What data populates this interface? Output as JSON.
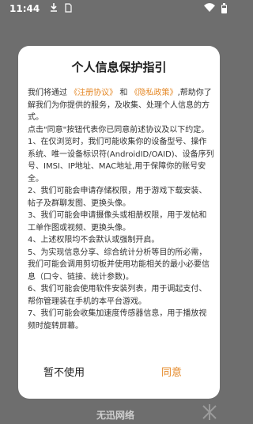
{
  "status_bar": {
    "time": "11:44",
    "icons": [
      "download-icon",
      "sim-card-icon",
      "wifi-icon",
      "battery-icon"
    ]
  },
  "dialog": {
    "title": "个人信息保护指引",
    "intro_prefix": "我们将通过",
    "link_terms": "《注册协议》",
    "intro_and": "和",
    "link_privacy": "《隐私政策》",
    "intro_suffix": ",帮助你了解我们为你提供的服务，及收集、处理个人信息的方式。",
    "consent_note": "点击\"同意\"按钮代表你已同意前述协议及以下约定。",
    "items": [
      "1、在仅浏览时，我们可能收集你的设备型号、操作系统、唯一设备标识符(AndroidID/OAID)、设备序列号、IMSI、IP地址、MAC地址,用于保障你的账号安全。",
      "2、我们可能会申请存储权限，用于游戏下载安装、帖子及群聊发图、更换头像。",
      "3、我们可能会申请摄像头或相册权限，用于发帖和工单作图或视频、更换头像。",
      "4、上述权限均不会默认或强制开启。",
      "5、为实现信息分享、综合统计分析等目的所必需，我们可能会调用剪切板并使用功能相关的最小必要信息（口令、链接、统计参数)。",
      "6、我们可能会使用软件安装列表，用于调起支付、帮你管理装在手机的本平台游戏。",
      "7、我们可能会收集加速度传感器信息，用于播放视频时旋转屏幕。"
    ],
    "decline_label": "暂不使用",
    "agree_label": "同意",
    "accent_color": "#e58a2a"
  },
  "background": {
    "partial_text": "无迅网络"
  }
}
